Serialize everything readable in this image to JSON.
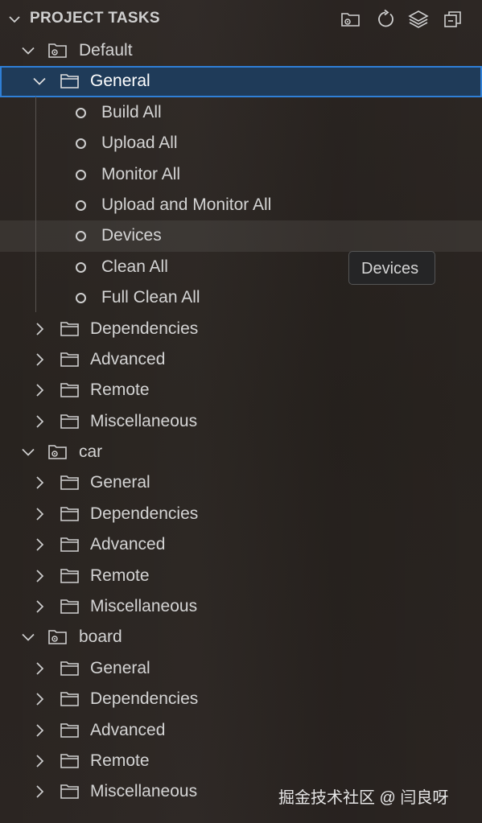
{
  "header": {
    "title": "PROJECT TASKS",
    "icons": [
      "new-folder-terminal-icon",
      "refresh-icon",
      "layers-icon",
      "collapse-all-icon"
    ]
  },
  "projects": [
    {
      "name": "Default",
      "general": {
        "label": "General",
        "tasks": [
          "Build All",
          "Upload All",
          "Monitor All",
          "Upload and Monitor All",
          "Devices",
          "Clean All",
          "Full Clean All"
        ]
      },
      "folders": [
        "Dependencies",
        "Advanced",
        "Remote",
        "Miscellaneous"
      ]
    },
    {
      "name": "car",
      "folders": [
        "General",
        "Dependencies",
        "Advanced",
        "Remote",
        "Miscellaneous"
      ]
    },
    {
      "name": "board",
      "folders": [
        "General",
        "Dependencies",
        "Advanced",
        "Remote",
        "Miscellaneous"
      ]
    }
  ],
  "tooltip": {
    "text": "Devices"
  },
  "watermark": "掘金技术社区 @ 闫良呀",
  "colors": {
    "selection_bg": "#1f3b59",
    "selection_border": "#2f7fd6",
    "text": "#d4d4d4"
  }
}
